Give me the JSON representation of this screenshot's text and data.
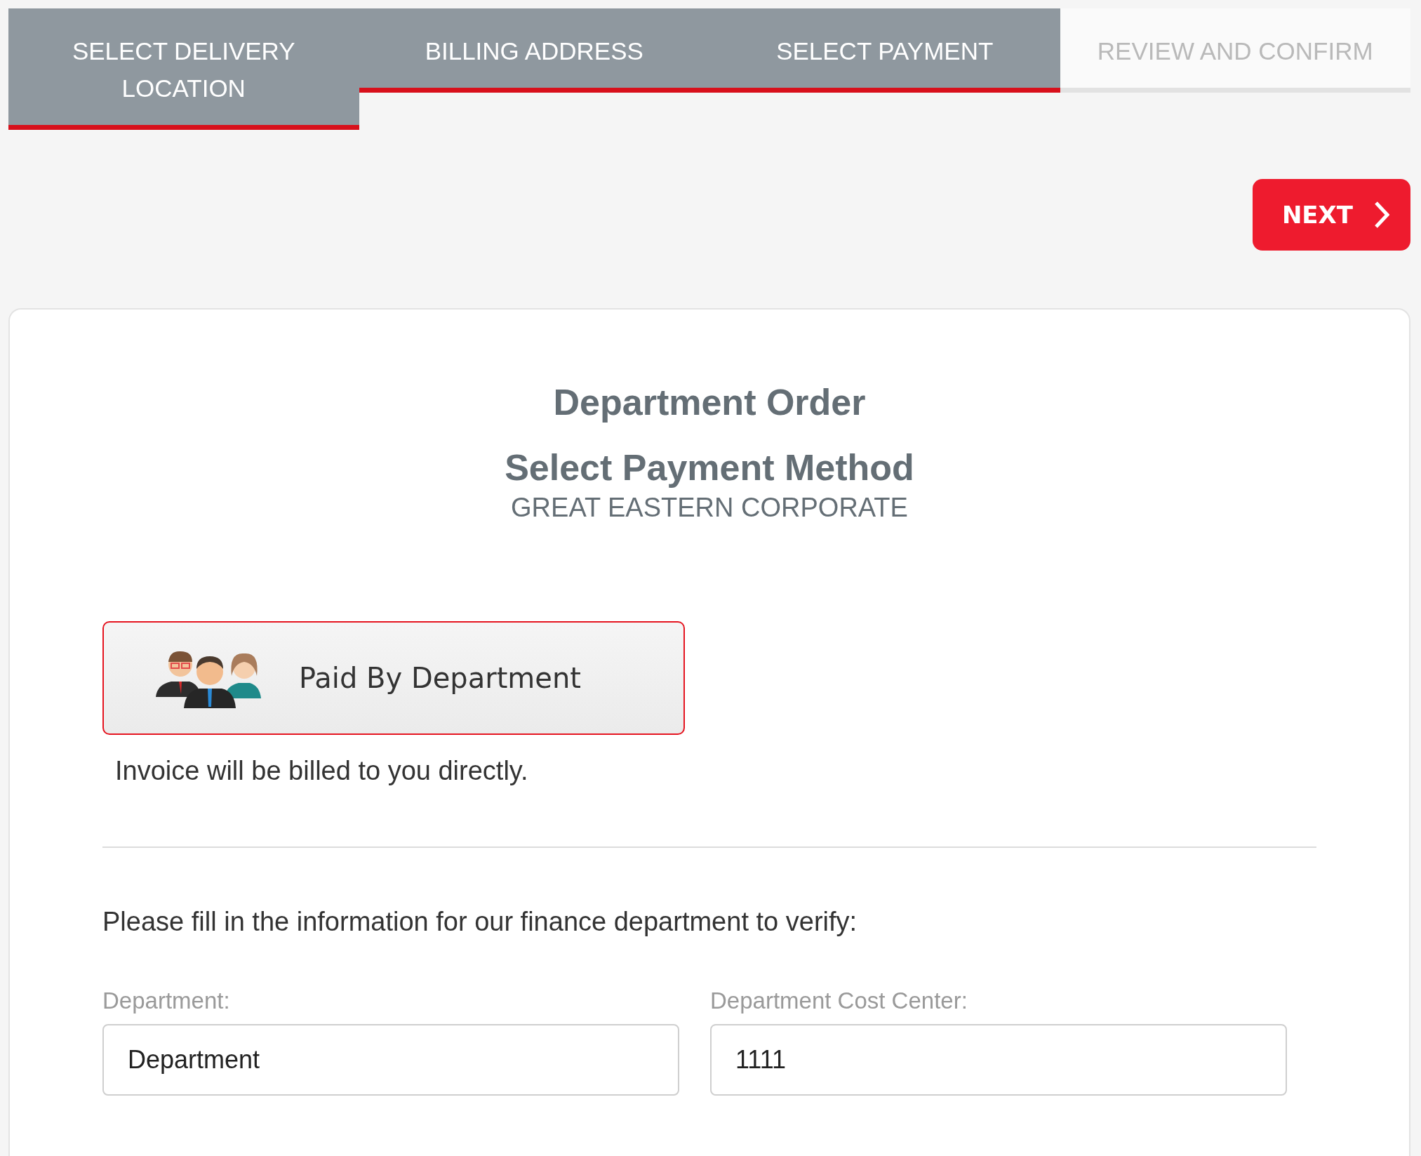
{
  "steps": [
    {
      "label": "SELECT DELIVERY LOCATION",
      "completed": true
    },
    {
      "label": "BILLING ADDRESS",
      "completed": true
    },
    {
      "label": "SELECT PAYMENT",
      "completed": true
    },
    {
      "label": "REVIEW AND CONFIRM",
      "completed": false
    }
  ],
  "next_button": {
    "label": "NEXT"
  },
  "card": {
    "title": "Department Order",
    "subtitle": "Select Payment Method",
    "company": "GREAT EASTERN CORPORATE",
    "payment_options": [
      {
        "label": "Paid By Department",
        "selected": true
      }
    ],
    "description": "Invoice will be billed to you directly.",
    "prompt": "Please fill in the information for our finance department to verify:",
    "fields": [
      {
        "label": "Department:",
        "value": "Department"
      },
      {
        "label": "Department Cost Center:",
        "value": "1111"
      }
    ]
  }
}
